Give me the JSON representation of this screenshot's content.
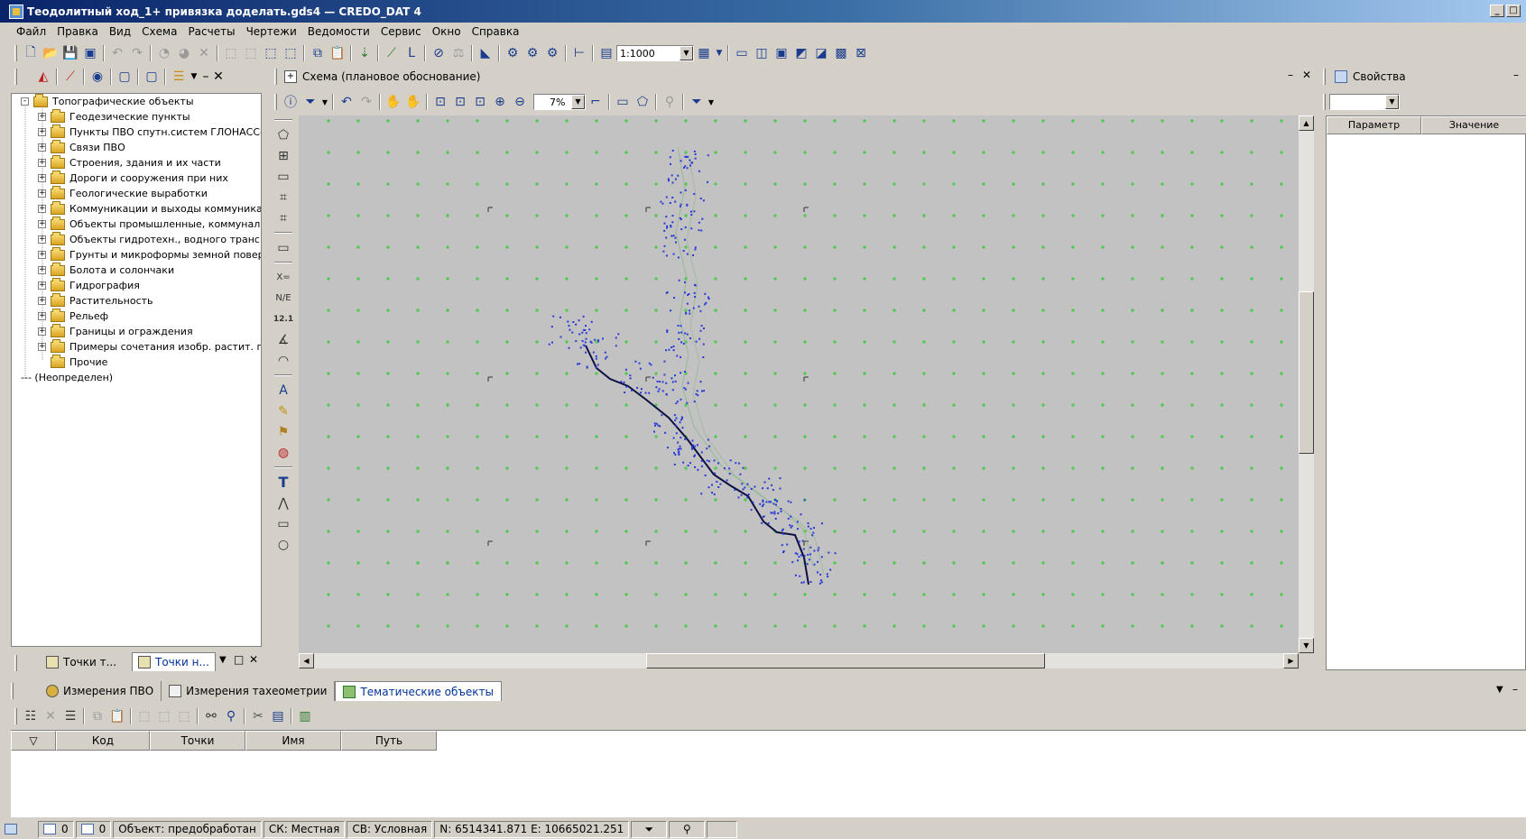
{
  "window": {
    "title": "Теодолитный ход_1+ привязка доделать.gds4 — CREDO_DAT 4",
    "controls": [
      "_",
      "□"
    ]
  },
  "menu": [
    "Файл",
    "Правка",
    "Вид",
    "Схема",
    "Расчеты",
    "Чертежи",
    "Ведомости",
    "Сервис",
    "Окно",
    "Справка"
  ],
  "main_toolbar": {
    "scale": "1:1000"
  },
  "left_panel": {
    "tree": [
      {
        "label": "Топографические объекты",
        "level": 0,
        "expander": "-"
      },
      {
        "label": "Геодезические пункты",
        "level": 1,
        "expander": "+"
      },
      {
        "label": "Пункты ПВО спутн.систем ГЛОНАСС-G",
        "level": 1,
        "expander": "+"
      },
      {
        "label": "Связи ПВО",
        "level": 1,
        "expander": "+"
      },
      {
        "label": "Строения, здания и их части",
        "level": 1,
        "expander": "+"
      },
      {
        "label": "Дороги и сооружения при них",
        "level": 1,
        "expander": "+"
      },
      {
        "label": "Геологические выработки",
        "level": 1,
        "expander": "+"
      },
      {
        "label": "Коммуникации и выходы коммуникаци",
        "level": 1,
        "expander": "+"
      },
      {
        "label": "Объекты промышленные, коммунальн",
        "level": 1,
        "expander": "+"
      },
      {
        "label": "Объекты гидротехн., водного трансп",
        "level": 1,
        "expander": "+"
      },
      {
        "label": "Грунты и микроформы земной поверх",
        "level": 1,
        "expander": "+"
      },
      {
        "label": "Болота и солончаки",
        "level": 1,
        "expander": "+"
      },
      {
        "label": "Гидрография",
        "level": 1,
        "expander": "+"
      },
      {
        "label": "Растительность",
        "level": 1,
        "expander": "+"
      },
      {
        "label": "Рельеф",
        "level": 1,
        "expander": "+"
      },
      {
        "label": "Границы и ограждения",
        "level": 1,
        "expander": "+"
      },
      {
        "label": "Примеры сочетания изобр. растит. гр",
        "level": 1,
        "expander": "+"
      },
      {
        "label": "Прочие",
        "level": 1,
        "expander": ""
      },
      {
        "label": "--- (Неопределен)",
        "level": 0,
        "expander": ""
      }
    ],
    "tabs": [
      "Точки т...",
      "Точки н..."
    ],
    "tab_controls": [
      "▼",
      "□",
      "✕"
    ]
  },
  "scheme_window": {
    "title": "Схема (плановое обоснование)",
    "zoom": "7%",
    "controls": [
      "–",
      "✕"
    ]
  },
  "properties": {
    "title": "Свойства",
    "columns": [
      "Параметр",
      "Значение"
    ]
  },
  "bottom": {
    "tabs": [
      "Измерения ПВО",
      "Измерения тахеометрии",
      "Тематические объекты"
    ],
    "active_tab": 2,
    "columns": [
      "Код",
      "Точки",
      "Имя",
      "Путь"
    ]
  },
  "status": {
    "count1": "0",
    "count2": "0",
    "object": "Объект:  предобработан",
    "cs": "СК: Местная",
    "height_system": "СВ: Условная",
    "coords": "N: 6514341.871  E: 10665021.251"
  },
  "colors": {
    "title_start": "#0a246a",
    "title_end": "#a6caf0",
    "map_background": "#c2c2c2",
    "grid_cross": "#2ccc2c",
    "traverse_line": "#0d1040",
    "points": "#2a3ad8",
    "active_tab_text": "#003399"
  }
}
